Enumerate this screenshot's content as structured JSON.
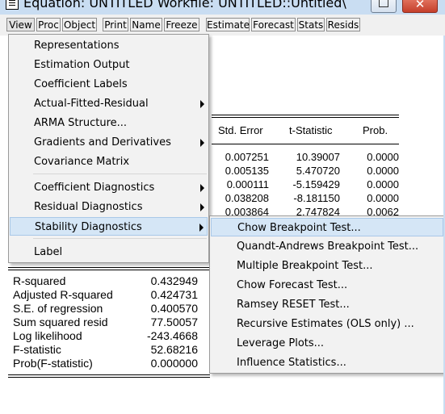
{
  "window": {
    "title": "Equation: UNTITLED   Workfile: UNTITLED::Untitled\\",
    "close_glyph": "✕"
  },
  "toolbar": {
    "buttons": [
      "View",
      "Proc",
      "Object",
      "Print",
      "Name",
      "Freeze",
      "Estimate",
      "Forecast",
      "Stats",
      "Resids"
    ]
  },
  "table": {
    "headers": [
      "Std. Error",
      "t-Statistic",
      "Prob."
    ],
    "rows": [
      [
        "0.007251",
        "10.39007",
        "0.0000"
      ],
      [
        "0.005135",
        "5.470720",
        "0.0000"
      ],
      [
        "0.000111",
        "-5.159429",
        "0.0000"
      ],
      [
        "0.038208",
        "-8.181150",
        "0.0000"
      ],
      [
        "0.003864",
        "2.747824",
        "0.0062"
      ]
    ]
  },
  "stats": [
    {
      "label": "R-squared",
      "value": "0.432949"
    },
    {
      "label": "Adjusted R-squared",
      "value": "0.424731"
    },
    {
      "label": "S.E. of regression",
      "value": "0.400570"
    },
    {
      "label": "Sum squared resid",
      "value": "77.50057"
    },
    {
      "label": "Log likelihood",
      "value": "-243.4668"
    },
    {
      "label": "F-statistic",
      "value": "52.68216"
    },
    {
      "label": "Prob(F-statistic)",
      "value": "0.000000"
    }
  ],
  "view_menu": {
    "items": [
      {
        "label": "Representations",
        "submenu": false
      },
      {
        "label": "Estimation Output",
        "submenu": false
      },
      {
        "label": "Coefficient Labels",
        "submenu": false
      },
      {
        "label": "Actual-Fitted-Residual",
        "submenu": true
      },
      {
        "label": "ARMA Structure...",
        "submenu": false
      },
      {
        "label": "Gradients and Derivatives",
        "submenu": true
      },
      {
        "label": "Covariance Matrix",
        "submenu": false
      },
      {
        "label": "Coefficient Diagnostics",
        "submenu": true
      },
      {
        "label": "Residual Diagnostics",
        "submenu": true
      },
      {
        "label": "Stability Diagnostics",
        "submenu": true,
        "highlighted": true
      },
      {
        "label": "Label",
        "submenu": false
      }
    ]
  },
  "stability_submenu": {
    "items": [
      {
        "label": "Chow Breakpoint Test...",
        "highlighted": true
      },
      {
        "label": "Quandt-Andrews Breakpoint Test..."
      },
      {
        "label": "Multiple Breakpoint Test..."
      },
      {
        "label": "Chow Forecast Test..."
      },
      {
        "label": "Ramsey RESET Test..."
      },
      {
        "label": "Recursive Estimates (OLS only) ..."
      },
      {
        "label": "Leverage Plots..."
      },
      {
        "label": "Influence Statistics..."
      }
    ]
  },
  "colors": {
    "titlebar": "#c9ddf2",
    "menu_highlight": "#d5e6f6",
    "close_button": "#c53f2b"
  }
}
